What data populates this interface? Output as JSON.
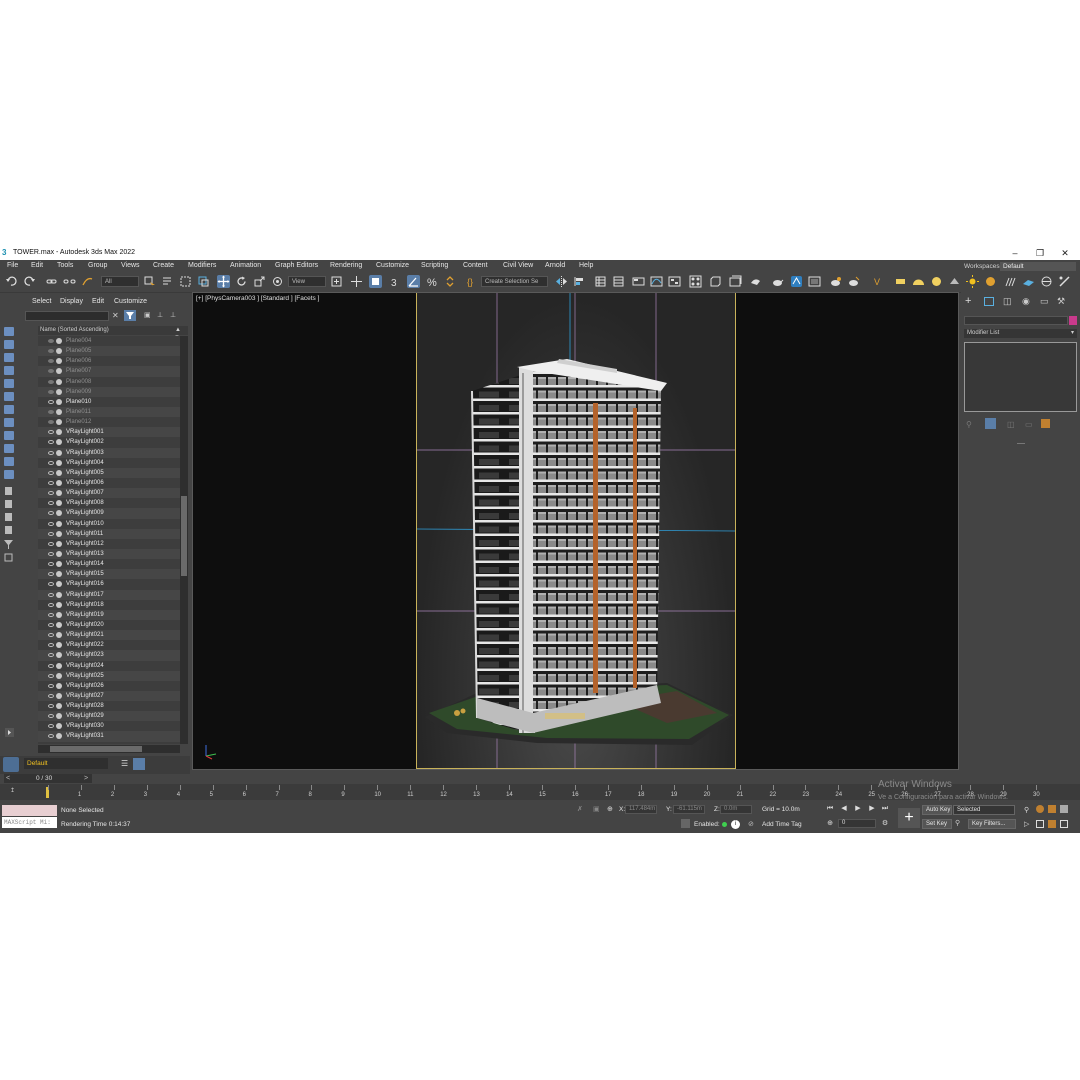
{
  "window": {
    "title": "TOWER.max - Autodesk 3ds Max 2022"
  },
  "menu": [
    "File",
    "Edit",
    "Tools",
    "Group",
    "Views",
    "Create",
    "Modifiers",
    "Animation",
    "Graph Editors",
    "Rendering",
    "Customize",
    "Scripting",
    "Content",
    "Civil View",
    "Arnold",
    "Help"
  ],
  "workspace": {
    "label": "Workspaces:",
    "value": "Default"
  },
  "toolbar": {
    "filter": "All",
    "ref_coord": "View",
    "selection_set": "Create Selection Se"
  },
  "scene_explorer": {
    "tabs": [
      "Select",
      "Display",
      "Edit",
      "Customize"
    ],
    "column_header": "Name (Sorted Ascending)",
    "column_header_right": "▲ Fr",
    "rows": [
      {
        "name": "Plane004",
        "hidden": true
      },
      {
        "name": "Plane005",
        "hidden": true
      },
      {
        "name": "Plane006",
        "hidden": true
      },
      {
        "name": "Plane007",
        "hidden": true
      },
      {
        "name": "Plane008",
        "hidden": true
      },
      {
        "name": "Plane009",
        "hidden": true
      },
      {
        "name": "Plane010",
        "hidden": false
      },
      {
        "name": "Plane011",
        "hidden": true
      },
      {
        "name": "Plane012",
        "hidden": true
      },
      {
        "name": "VRayLight001",
        "hidden": false
      },
      {
        "name": "VRayLight002",
        "hidden": false
      },
      {
        "name": "VRayLight003",
        "hidden": false
      },
      {
        "name": "VRayLight004",
        "hidden": false
      },
      {
        "name": "VRayLight005",
        "hidden": false
      },
      {
        "name": "VRayLight006",
        "hidden": false
      },
      {
        "name": "VRayLight007",
        "hidden": false
      },
      {
        "name": "VRayLight008",
        "hidden": false
      },
      {
        "name": "VRayLight009",
        "hidden": false
      },
      {
        "name": "VRayLight010",
        "hidden": false
      },
      {
        "name": "VRayLight011",
        "hidden": false
      },
      {
        "name": "VRayLight012",
        "hidden": false
      },
      {
        "name": "VRayLight013",
        "hidden": false
      },
      {
        "name": "VRayLight014",
        "hidden": false
      },
      {
        "name": "VRayLight015",
        "hidden": false
      },
      {
        "name": "VRayLight016",
        "hidden": false
      },
      {
        "name": "VRayLight017",
        "hidden": false
      },
      {
        "name": "VRayLight018",
        "hidden": false
      },
      {
        "name": "VRayLight019",
        "hidden": false
      },
      {
        "name": "VRayLight020",
        "hidden": false
      },
      {
        "name": "VRayLight021",
        "hidden": false
      },
      {
        "name": "VRayLight022",
        "hidden": false
      },
      {
        "name": "VRayLight023",
        "hidden": false
      },
      {
        "name": "VRayLight024",
        "hidden": false
      },
      {
        "name": "VRayLight025",
        "hidden": false
      },
      {
        "name": "VRayLight026",
        "hidden": false
      },
      {
        "name": "VRayLight027",
        "hidden": false
      },
      {
        "name": "VRayLight028",
        "hidden": false
      },
      {
        "name": "VRayLight029",
        "hidden": false
      },
      {
        "name": "VRayLight030",
        "hidden": false
      },
      {
        "name": "VRayLight031",
        "hidden": false
      }
    ]
  },
  "layer": {
    "name": "Default"
  },
  "viewport": {
    "label": "[+] [PhysCamera003 ] [Standard ] [Facets ]"
  },
  "command_panel": {
    "modifier_list": "Modifier List"
  },
  "timeline": {
    "slider_label": "0 / 30",
    "ticks": [
      "0",
      "1",
      "2",
      "3",
      "4",
      "5",
      "6",
      "7",
      "8",
      "9",
      "10",
      "11",
      "12",
      "13",
      "14",
      "15",
      "16",
      "17",
      "18",
      "19",
      "20",
      "21",
      "22",
      "23",
      "24",
      "25",
      "26",
      "27",
      "28",
      "29",
      "30"
    ]
  },
  "status": {
    "maxscript": "MAXScript Mi:",
    "selection": "None Selected",
    "render_time_label": "Rendering Time  0:14:37",
    "x_label": "X:",
    "x_value": "117.484m",
    "y_label": "Y:",
    "y_value": "-61.115m",
    "z_label": "Z:",
    "z_value": "0.0m",
    "grid": "Grid = 10.0m",
    "enabled_label": "Enabled:",
    "add_time_tag": "Add Time Tag",
    "auto_key": "Auto Key",
    "selected": "Selected",
    "set_key": "Set Key",
    "key_filters": "Key Filters...",
    "frame": "0"
  },
  "watermark": {
    "line1": "Activar Windows",
    "line2": "Ve a Configuración para activar Windows."
  }
}
